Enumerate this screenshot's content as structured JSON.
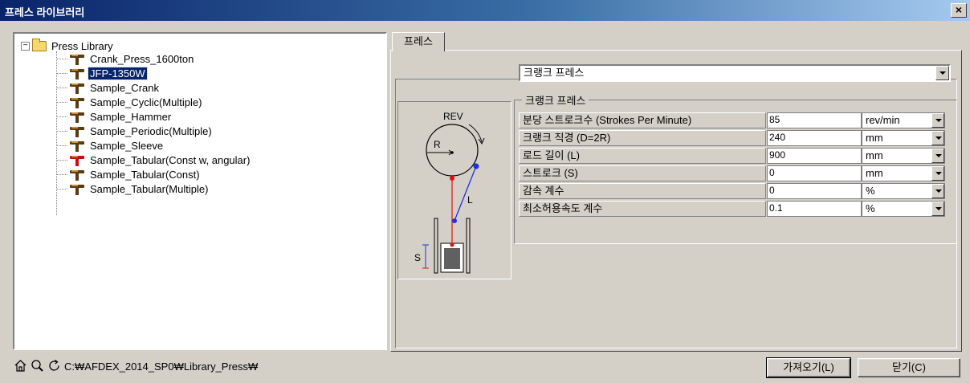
{
  "window": {
    "title": "프레스 라이브러리",
    "close_label": "×"
  },
  "tree": {
    "root_expander": "−",
    "root_label": "Press Library",
    "items": [
      {
        "label": "Crank_Press_1600ton",
        "icon": "press-icon"
      },
      {
        "label": "JFP-1350W",
        "icon": "press-icon",
        "selected": true
      },
      {
        "label": "Sample_Crank",
        "icon": "press-icon"
      },
      {
        "label": "Sample_Cyclic(Multiple)",
        "icon": "press-icon"
      },
      {
        "label": "Sample_Hammer",
        "icon": "press-icon"
      },
      {
        "label": "Sample_Periodic(Multiple)",
        "icon": "press-icon"
      },
      {
        "label": "Sample_Sleeve",
        "icon": "press-icon"
      },
      {
        "label": "Sample_Tabular(Const w, angular)",
        "icon": "press-error-icon"
      },
      {
        "label": "Sample_Tabular(Const)",
        "icon": "press-icon"
      },
      {
        "label": "Sample_Tabular(Multiple)",
        "icon": "press-icon"
      }
    ]
  },
  "bottom": {
    "icons": [
      "home-icon",
      "search-icon",
      "refresh-icon"
    ],
    "path": "C:₩AFDEX_2014_SP0₩Library_Press₩",
    "import_label": "가져오기(L)",
    "close_label": "닫기(C)"
  },
  "tab": {
    "label": "프레스"
  },
  "press_type": {
    "selected": "크랭크 프레스"
  },
  "diagram": {
    "rev_label": "REV",
    "r_label": "R",
    "l_label": "L",
    "s_label": "S",
    "colors": {
      "crank_circle": "#000000",
      "rod": "#2030e0",
      "slide_line": "#e01010",
      "ram": "#606060"
    }
  },
  "group": {
    "title": "크랭크 프레스",
    "params": [
      {
        "label": "분당 스트로크수 (Strokes Per Minute)",
        "value": "85",
        "unit": "rev/min"
      },
      {
        "label": "크랭크 직경 (D=2R)",
        "value": "240",
        "unit": "mm"
      },
      {
        "label": "로드 길이 (L)",
        "value": "900",
        "unit": "mm"
      },
      {
        "label": "스트로크 (S)",
        "value": "0",
        "unit": "mm"
      },
      {
        "label": "감속 계수",
        "value": "0",
        "unit": "%"
      },
      {
        "label": "최소허용속도 계수",
        "value": "0.1",
        "unit": "%"
      }
    ]
  }
}
